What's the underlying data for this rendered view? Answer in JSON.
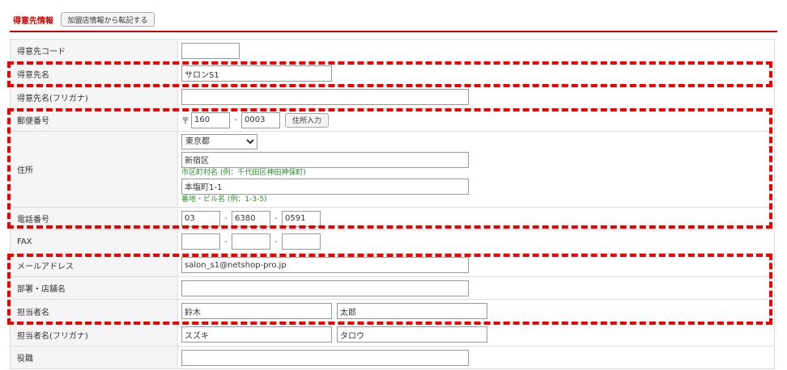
{
  "header": {
    "title": "得意先情報",
    "copy_button": "加盟店情報から転記する"
  },
  "fields": {
    "customer_code": {
      "label": "得意先コード",
      "value": ""
    },
    "customer_name": {
      "label": "得意先名",
      "value": "サロンS1"
    },
    "customer_name_kana": {
      "label": "得意先名(フリガナ)",
      "value": ""
    },
    "postal": {
      "label": "郵便番号",
      "mark": "〒",
      "part1": "160",
      "part2": "0003",
      "button": "住所入力",
      "dash": "-"
    },
    "address": {
      "label": "住所",
      "prefecture": "東京都",
      "city": "新宿区",
      "city_hint": "市区町村名 (例：千代田区神田神保町)",
      "street": "本塩町1-1",
      "street_hint": "番地・ビル名 (例：1-3-5)"
    },
    "phone": {
      "label": "電話番号",
      "part1": "03",
      "part2": "6380",
      "part3": "0591",
      "dash": "-"
    },
    "fax": {
      "label": "FAX",
      "part1": "",
      "part2": "",
      "part3": "",
      "dash": "-"
    },
    "email": {
      "label": "メールアドレス",
      "value": "salon_s1@netshop-pro.jp"
    },
    "department": {
      "label": "部署・店舗名",
      "value": ""
    },
    "person": {
      "label": "担当者名",
      "last": "鈴木",
      "first": "太郎"
    },
    "person_kana": {
      "label": "担当者名(フリガナ)",
      "last": "スズキ",
      "first": "タロウ"
    },
    "position": {
      "label": "役職",
      "value": ""
    }
  },
  "highlight_color": "#e00000",
  "accent_color": "#cc0000"
}
